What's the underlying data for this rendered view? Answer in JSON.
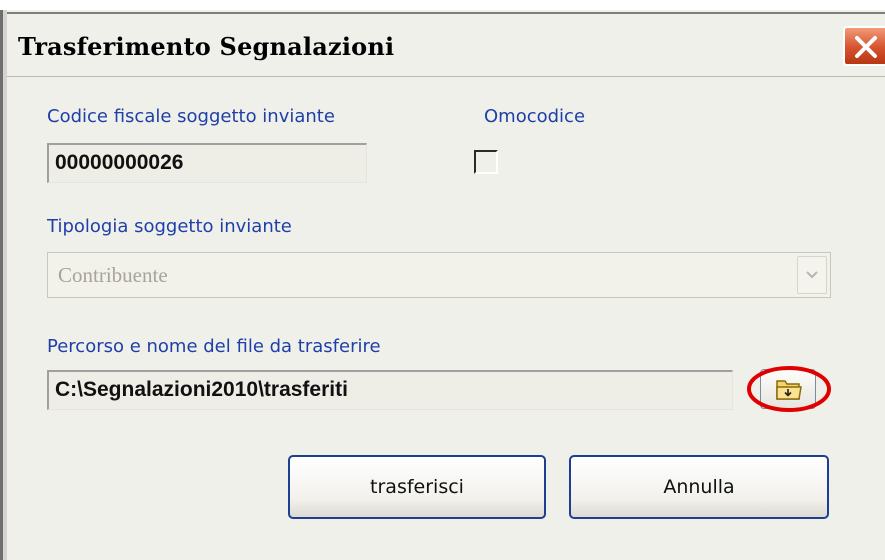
{
  "window": {
    "title": "Trasferimento Segnalazioni",
    "title_bar_color": "#f0f0ea",
    "close_button_color": "#d5532d"
  },
  "form": {
    "codice_fiscale": {
      "label": "Codice fiscale soggetto inviante",
      "value": "00000000026"
    },
    "omocodice": {
      "label": "Omocodice",
      "checked": false
    },
    "tipologia": {
      "label": "Tipologia soggetto inviante",
      "selected": "Contribuente",
      "enabled": false
    },
    "percorso": {
      "label": "Percorso e nome del file da trasferire",
      "value": "C:\\Segnalazioni2010\\trasferiti",
      "browse_icon": "folder-open-icon",
      "highlight_color": "#e00000"
    }
  },
  "buttons": {
    "transfer_label": "trasferisci",
    "cancel_label": "Annulla"
  },
  "colors": {
    "label_text": "#1f3fa8",
    "button_border": "#1d3f92"
  }
}
